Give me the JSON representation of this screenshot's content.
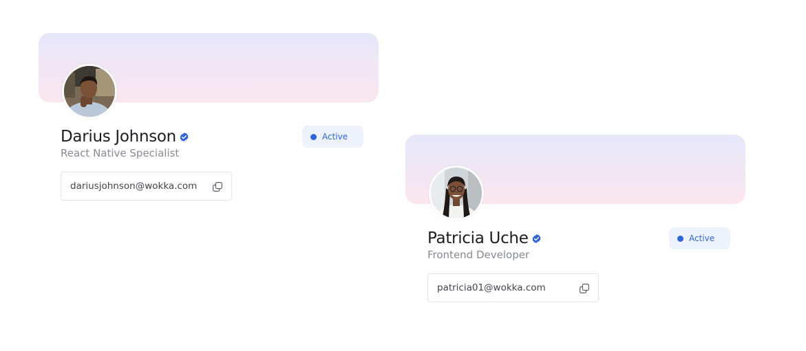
{
  "cards": [
    {
      "name": "Darius Johnson",
      "role": "React Native Specialist",
      "status": "Active",
      "email": "dariusjohnson@wokka.com"
    },
    {
      "name": "Patricia Uche",
      "role": "Frontend Developer",
      "status": "Active",
      "email": "patricia01@wokka.com"
    }
  ],
  "colors": {
    "accent": "#2f65d8",
    "badge_bg": "#eef2fd",
    "banner_top": "#e6e7fb",
    "banner_bottom": "#fbe6ee",
    "name_text": "#1c1d22",
    "muted_text": "#878a94"
  },
  "icons": {
    "verified": "verified-badge-icon",
    "copy": "copy-icon",
    "status": "status-dot"
  }
}
